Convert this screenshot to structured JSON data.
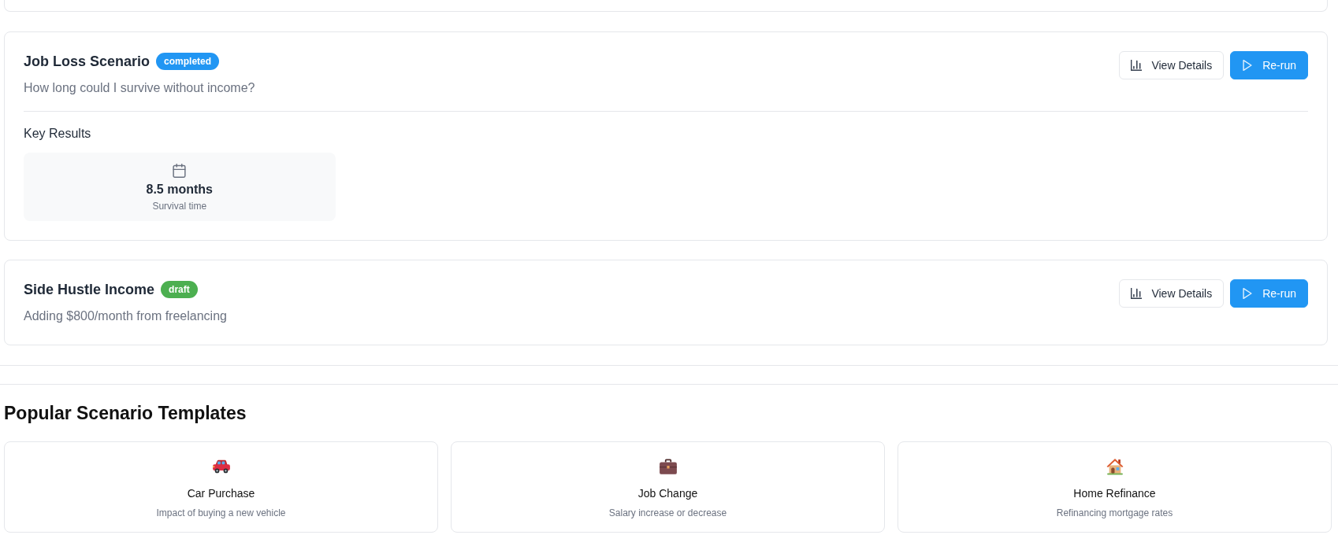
{
  "scenarios": [
    {
      "title": "Job Loss Scenario",
      "badge": {
        "text": "completed",
        "color": "#2196f3"
      },
      "description": "How long could I survive without income?",
      "actions": [
        {
          "label": "View Details",
          "kind": "details"
        },
        {
          "label": "Re-run",
          "kind": "rerun"
        }
      ],
      "key_results": {
        "heading": "Key Results",
        "items": [
          {
            "kind": "duration",
            "value": "8.5 months",
            "label": "Survival time"
          }
        ]
      }
    },
    {
      "title": "Side Hustle Income",
      "badge": {
        "text": "draft",
        "color": "#4caf50"
      },
      "description": "Adding $800/month from freelancing",
      "actions": [
        {
          "label": "View Details",
          "kind": "details"
        },
        {
          "label": "Re-run",
          "kind": "rerun"
        }
      ]
    }
  ],
  "templates": {
    "heading": "Popular Scenario Templates",
    "items": [
      {
        "kind": "vehicle",
        "title": "Car Purchase",
        "description": "Impact of buying a new vehicle"
      },
      {
        "kind": "job",
        "title": "Job Change",
        "description": "Salary increase or decrease"
      },
      {
        "kind": "home",
        "title": "Home Refinance",
        "description": "Refinancing mortgage rates"
      }
    ]
  }
}
